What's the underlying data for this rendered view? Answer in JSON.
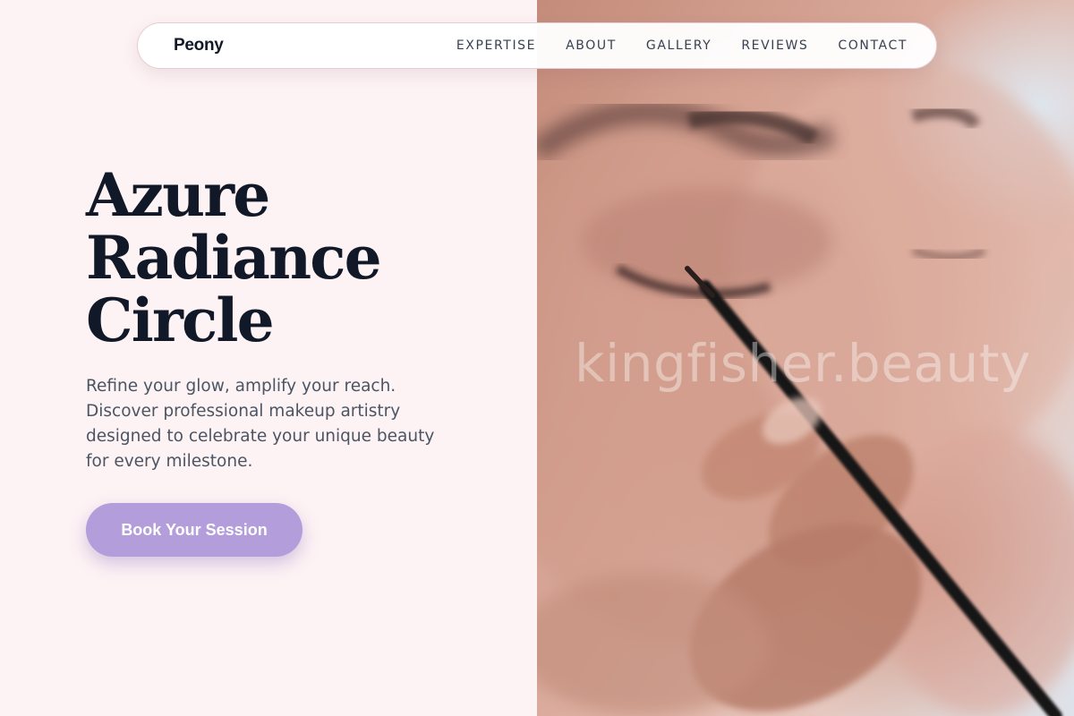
{
  "nav": {
    "brand": "Peony",
    "links": [
      "EXPERTISE",
      "ABOUT",
      "GALLERY",
      "REVIEWS",
      "CONTACT"
    ]
  },
  "hero": {
    "title_lines": [
      "Azure",
      "Radiance",
      "Circle"
    ],
    "subtitle": "Refine your glow, amplify your reach. Discover professional makeup artistry designed to celebrate your unique beauty for every milestone.",
    "cta_label": "Book Your Session"
  },
  "image": {
    "watermark": "kingfisher.beauty"
  },
  "colors": {
    "background": "#fdf2f4",
    "accent": "#b39ddb",
    "heading": "#111827",
    "body_text": "#4b5563"
  }
}
